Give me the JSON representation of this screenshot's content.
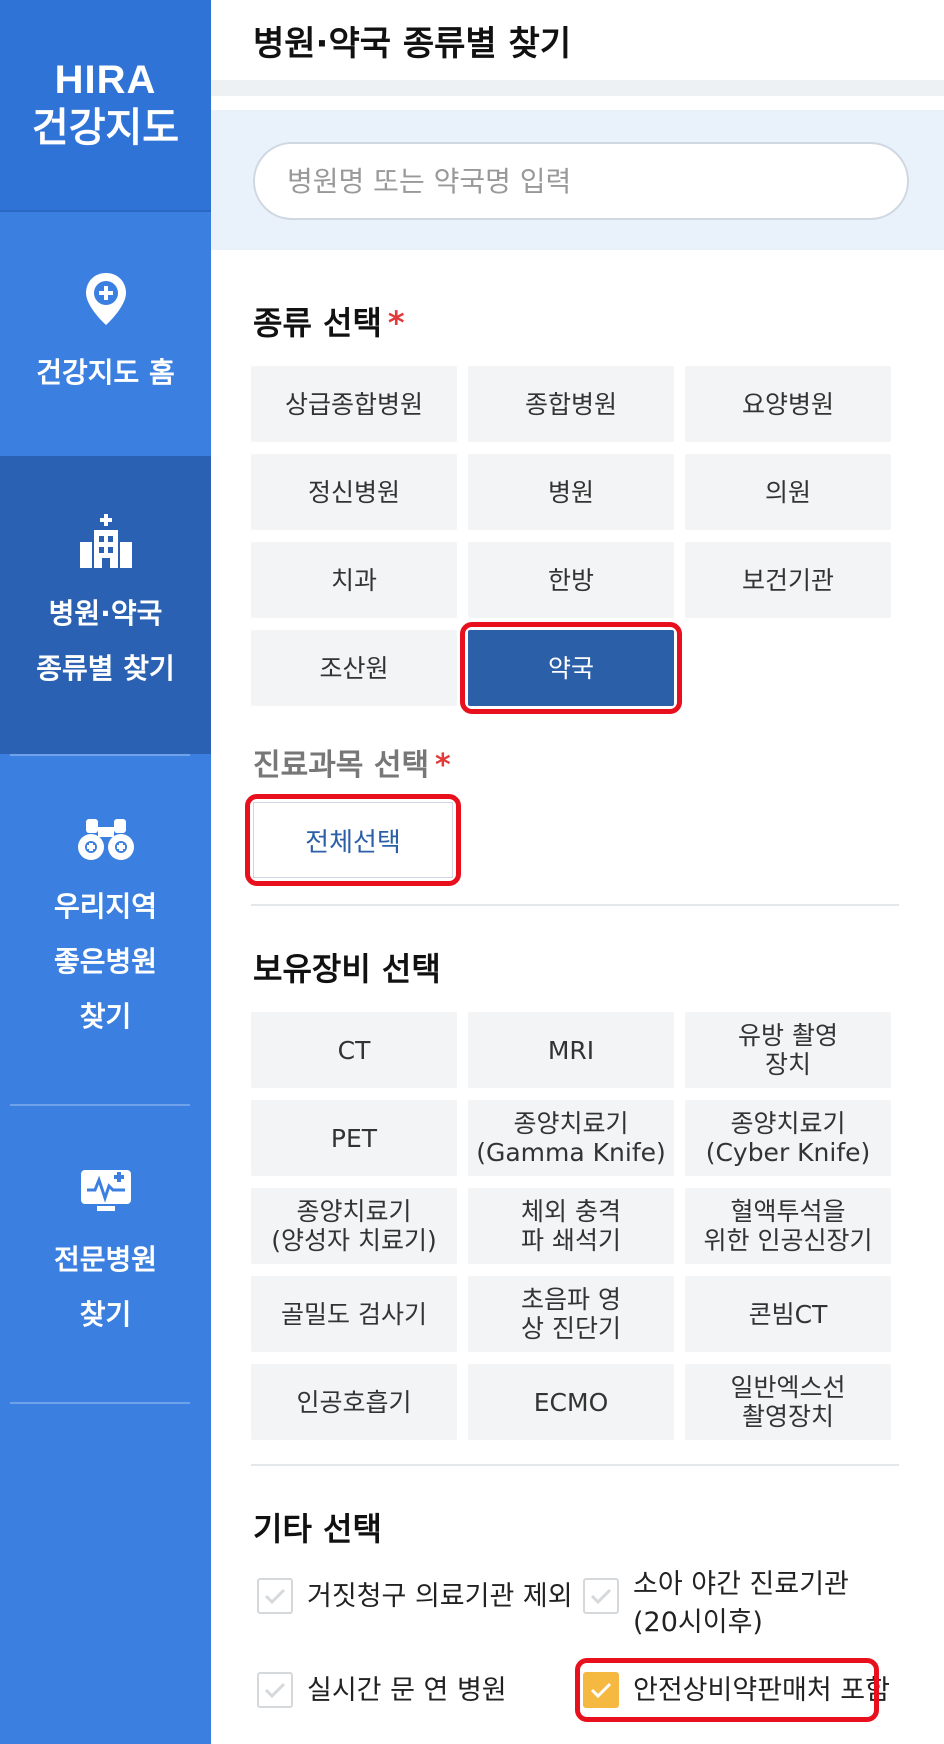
{
  "sidebar": {
    "logo_line1": "HIRA",
    "logo_line2": "건강지도",
    "items": [
      {
        "label": "건강지도 홈",
        "icon": "map-pin-plus-icon"
      },
      {
        "label": "병원·약국\n종류별 찾기",
        "icon": "hospital-building-icon"
      },
      {
        "label": "우리지역\n좋은병원\n찾기",
        "icon": "binoculars-icon"
      },
      {
        "label": "전문병원\n찾기",
        "icon": "medical-monitor-icon"
      }
    ]
  },
  "header": {
    "title": "병원·약국 종류별 찾기"
  },
  "search": {
    "placeholder": "병원명 또는 약국명 입력"
  },
  "type_section": {
    "title": "종류 선택",
    "required_mark": "*",
    "options": [
      "상급종합병원",
      "종합병원",
      "요양병원",
      "정신병원",
      "병원",
      "의원",
      "치과",
      "한방",
      "보건기관",
      "조산원",
      "약국"
    ],
    "selected": "약국"
  },
  "dept_section": {
    "title": "진료과목 선택",
    "required_mark": "*",
    "select_all_label": "전체선택"
  },
  "equip_section": {
    "title": "보유장비 선택",
    "options": [
      "CT",
      "MRI",
      "유방 촬영\n장치",
      "PET",
      "종양치료기\n(Gamma Knife)",
      "종양치료기\n(Cyber Knife)",
      "종양치료기\n(양성자 치료기)",
      "체외 충격\n파 쇄석기",
      "혈액투석을\n위한 인공신장기",
      "골밀도 검사기",
      "초음파 영\n상 진단기",
      "콘빔CT",
      "인공호흡기",
      "ECMO",
      "일반엑스선\n촬영장치"
    ]
  },
  "etc_section": {
    "title": "기타 선택",
    "options": [
      {
        "label": "거짓청구 의료기관 제외",
        "checked": false
      },
      {
        "label": "소아 야간 진료기관\n(20시이후)",
        "checked": false
      },
      {
        "label": "실시간 문 연 병원",
        "checked": false
      },
      {
        "label": "안전상비약판매처 포함",
        "checked": true
      }
    ]
  },
  "colors": {
    "sidebar_bg": "#3b7fe0",
    "sidebar_active": "#2b61b3",
    "selected_btn": "#2b5fa8",
    "highlight": "#e8101c",
    "checked": "#f5b942"
  }
}
